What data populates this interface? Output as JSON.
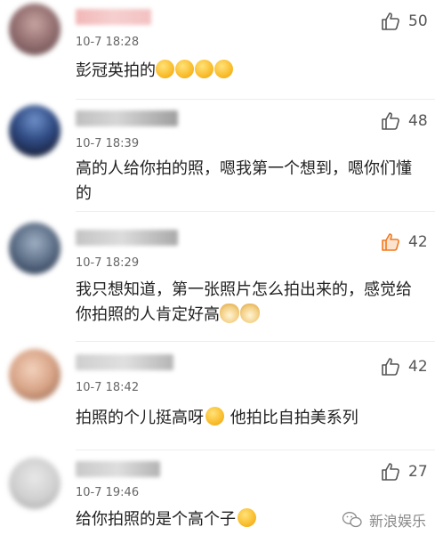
{
  "comments": [
    {
      "time": "10-7 18:28",
      "text": "彭冠英拍的",
      "likes": "50",
      "liked": false
    },
    {
      "time": "10-7 18:39",
      "text": "高的人给你拍的照，嗯我第一个想到，嗯你们懂的",
      "likes": "48",
      "liked": false
    },
    {
      "time": "10-7 18:29",
      "text": "我只想知道，第一张照片怎么拍出来的，感觉给你拍照的人肯定好高",
      "likes": "42",
      "liked": true
    },
    {
      "time": "10-7 18:42",
      "text_a": "拍照的个儿挺高呀",
      "text_b": " 他拍比自拍美系列",
      "likes": "42",
      "liked": false
    },
    {
      "time": "10-7 19:46",
      "text": "给你拍照的是个高个子",
      "likes": "27",
      "liked": false
    }
  ],
  "watermark": {
    "text": "新浪娱乐"
  },
  "colors": {
    "liked": "#f07a1f",
    "like_icon": "#555555"
  }
}
